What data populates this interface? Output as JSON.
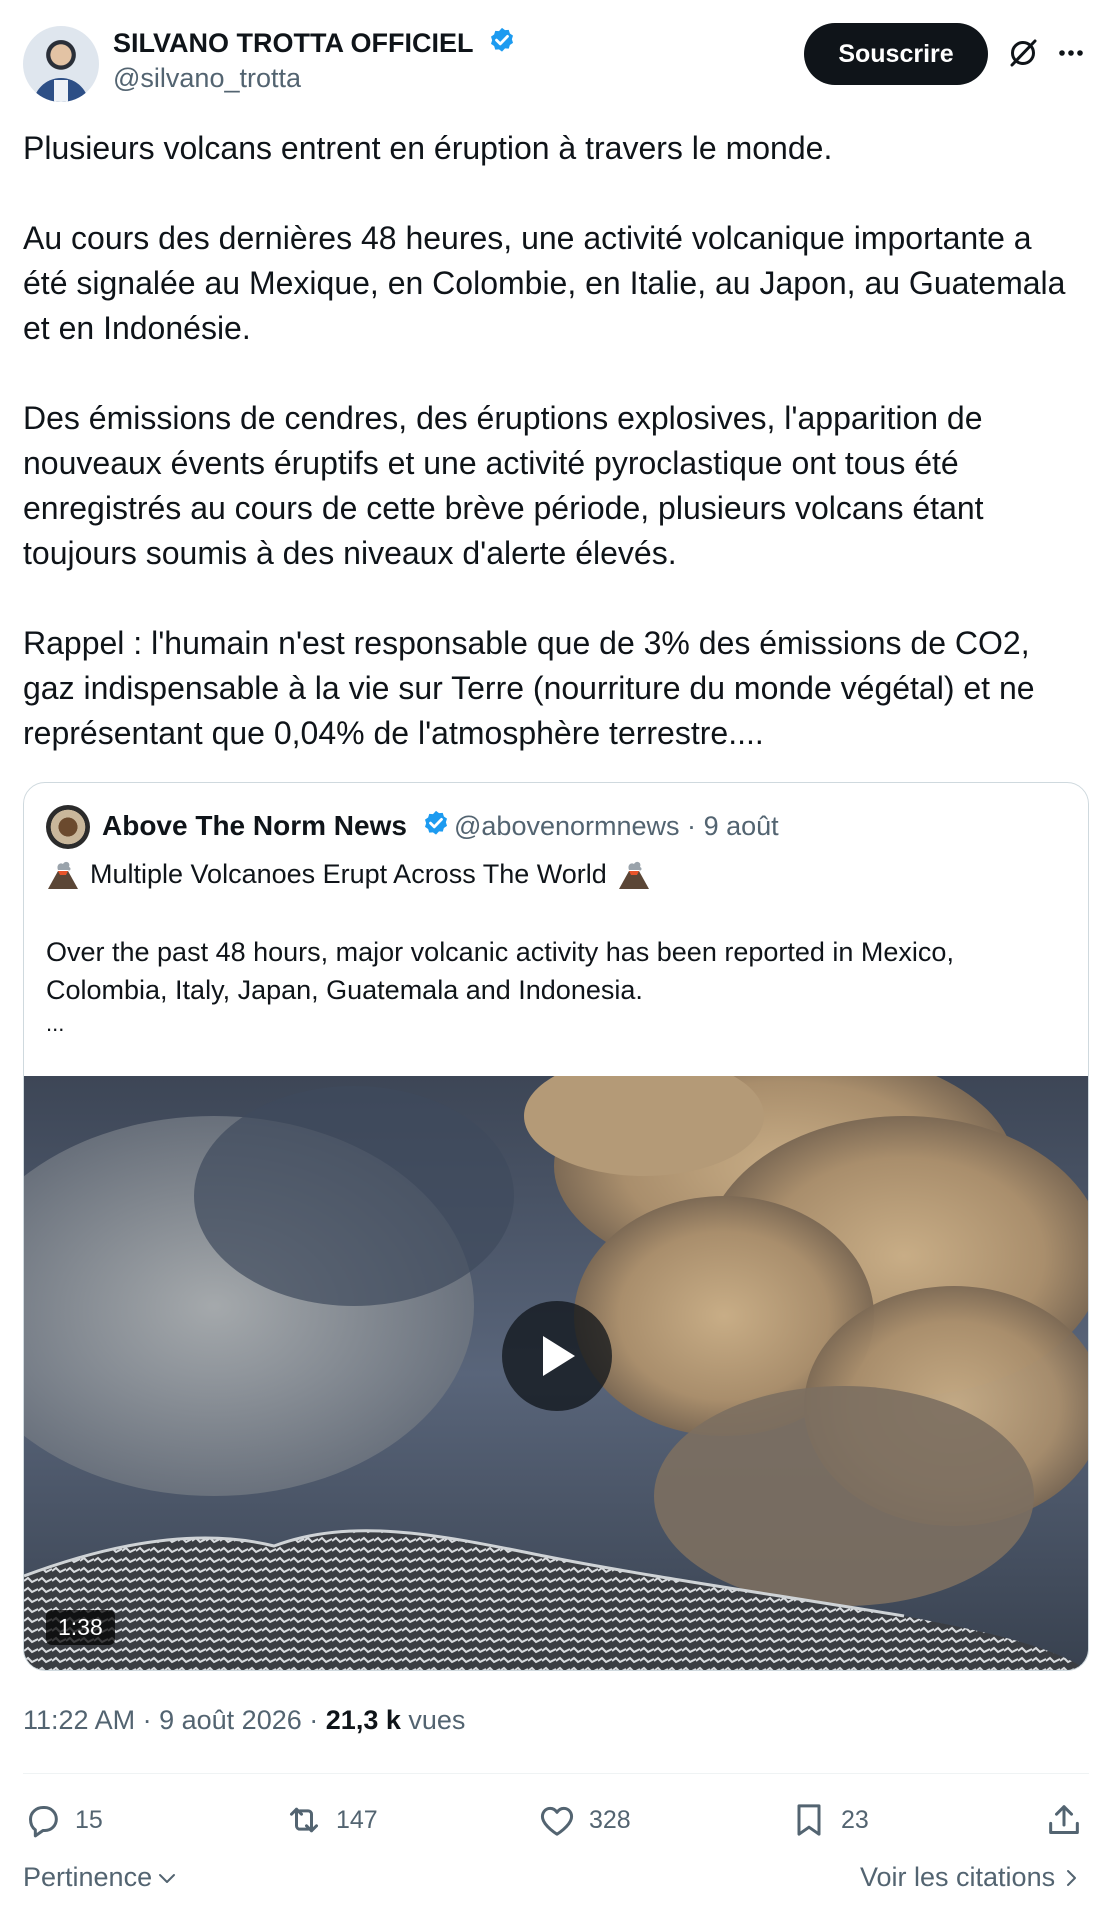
{
  "author": {
    "name": "SILVANO TROTTA OFFICIEL",
    "handle": "@silvano_trotta",
    "subscribe_label": "Souscrire"
  },
  "tweet": {
    "paragraphs": [
      "Plusieurs volcans entrent en éruption à travers le monde.",
      "Au cours des dernières 48 heures, une activité volcanique importante a été signalée au Mexique, en Colombie, en Italie, au Japon, au Guatemala et en Indonésie.",
      "Des émissions de cendres, des éruptions explosives, l'apparition de nouveaux évents éruptifs et une activité pyroclastique ont tous été enregistrés au cours de cette brève période, plusieurs volcans étant toujours soumis à des niveaux d'alerte élevés.",
      "Rappel : l'humain n'est responsable que de 3% des émissions de CO2, gaz indispensable à la vie sur Terre (nourriture du monde végétal) et ne représentant que 0,04% de l'atmosphère terrestre...."
    ]
  },
  "quote": {
    "name": "Above The Norm News",
    "handle": "@abovenormnews",
    "separator": "·",
    "date": "9 août",
    "title": "Multiple Volcanoes Erupt Across The World",
    "text": "Over the past 48 hours, major volcanic activity has been reported in Mexico, Colombia, Italy, Japan, Guatemala and Indonesia.",
    "more": "...",
    "video_duration": "1:38"
  },
  "meta": {
    "time": "11:22 AM",
    "separator": "·",
    "date": "9 août 2026",
    "views_count": "21,3 k",
    "views_label": "vues"
  },
  "actions": {
    "replies": "15",
    "reposts": "147",
    "likes": "328",
    "bookmarks": "23"
  },
  "footer": {
    "sort_label": "Pertinence",
    "quotes_link": "Voir les citations"
  },
  "colors": {
    "verified": "#1d9bf0",
    "text": "#0f1419",
    "secondary": "#536471",
    "border": "#cfd9de"
  },
  "icons": [
    "verified-badge-icon",
    "grok-icon",
    "more-icon",
    "volcano-icon",
    "play-icon",
    "reply-icon",
    "repost-icon",
    "like-icon",
    "bookmark-icon",
    "share-icon",
    "chevron-down-icon",
    "chevron-right-icon"
  ]
}
